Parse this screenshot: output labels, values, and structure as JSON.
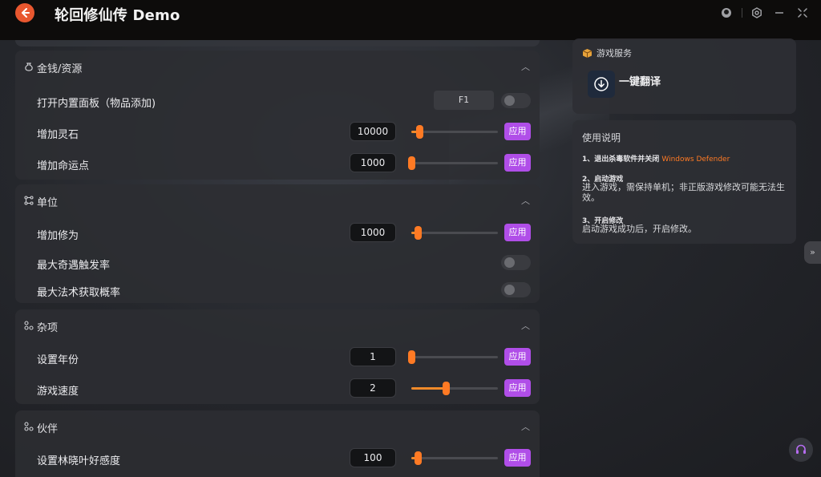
{
  "titlebar": {
    "title": "轮回修仙传 Demo",
    "icons": [
      "back-arrow-icon",
      "user-avatar-icon",
      "settings-icon",
      "minimize-icon",
      "close-icon"
    ]
  },
  "sections": [
    {
      "title": "金钱/资源",
      "icon": "money-bag-icon",
      "rows": [
        {
          "label": "打开内置面板（物品添加)",
          "type": "toggle-key",
          "key": "F1",
          "on": false
        },
        {
          "label": "增加灵石",
          "type": "slider",
          "value": "10000",
          "level": 0.09
        },
        {
          "label": "增加命运点",
          "type": "slider",
          "value": "1000",
          "level": 0.0
        }
      ]
    },
    {
      "title": "单位",
      "icon": "unit-nodes-icon",
      "rows": [
        {
          "label": "增加修为",
          "type": "slider",
          "value": "1000",
          "level": 0.07
        },
        {
          "label": "最大奇遇触发率",
          "type": "toggle",
          "on": false
        },
        {
          "label": "最大法术获取概率",
          "type": "toggle",
          "on": false
        }
      ]
    },
    {
      "title": "杂项",
      "icon": "misc-icon",
      "rows": [
        {
          "label": "设置年份",
          "type": "slider",
          "value": "1",
          "level": 0.0
        },
        {
          "label": "游戏速度",
          "type": "slider",
          "value": "2",
          "level": 0.4
        }
      ]
    },
    {
      "title": "伙伴",
      "icon": "partner-icon",
      "rows": [
        {
          "label": "设置林晓叶好感度",
          "type": "slider",
          "value": "100",
          "level": 0.07
        }
      ]
    }
  ],
  "apply_label": "应用",
  "service_card": {
    "title": "游戏服务",
    "item_label": "一键翻译"
  },
  "usage_card": {
    "title": "使用说明",
    "steps": [
      {
        "head": "1、退出杀毒软件并关闭",
        "accent": "Windows Defender",
        "body": ""
      },
      {
        "head": "2、启动游戏",
        "accent": "",
        "body": "进入游戏，需保持单机；非正版游戏修改可能无法生效。"
      },
      {
        "head": "3、开启修改",
        "accent": "",
        "body": "启动游戏成功后，开启修改。"
      }
    ]
  },
  "colors": {
    "accent_orange": "#ff7a24",
    "apply_purple": "#b04ee8",
    "titlebar_bg": "#0d0c0b"
  }
}
